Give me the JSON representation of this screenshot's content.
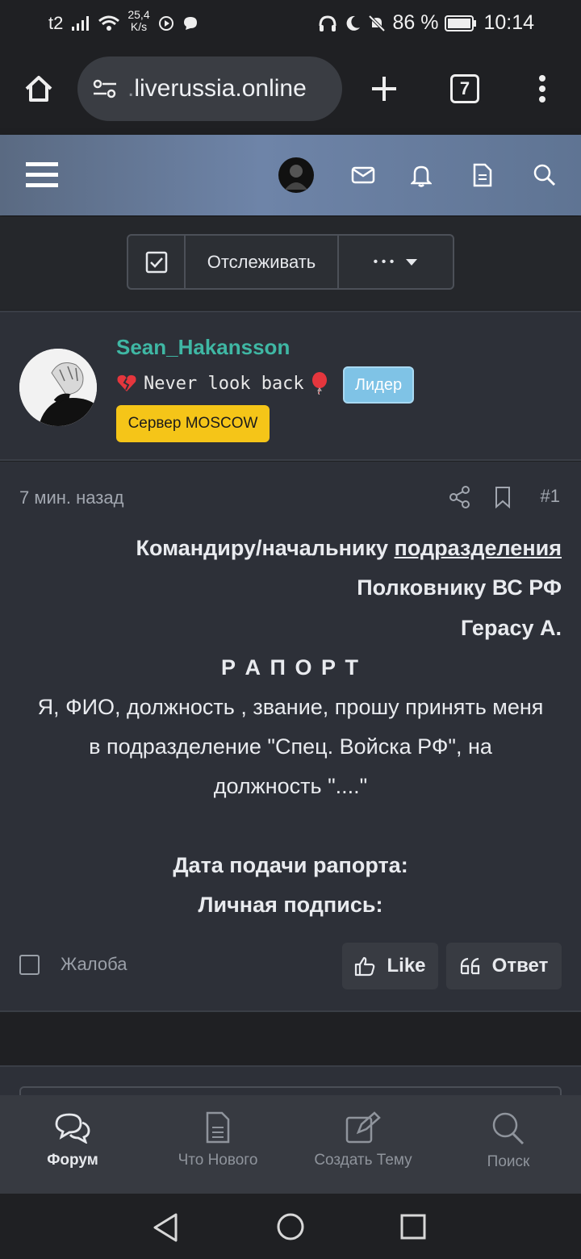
{
  "status": {
    "carrier": "t2",
    "speed_top": "25,4",
    "speed_bottom": "K/s",
    "battery": "86 %",
    "time": "10:14"
  },
  "browser": {
    "url_fade": "‎.",
    "url": "liverussia.online",
    "tab_count": "7"
  },
  "actions": {
    "follow_label": "Отслеживать",
    "more_label": "• • •"
  },
  "user": {
    "name": "Sean_Hakansson",
    "title": "Never look back",
    "leader_badge": "Лидер",
    "server_badge": "Сервер MOSCOW"
  },
  "post": {
    "time": "7 мин. назад",
    "number": "#1",
    "line1_a": "Командиру/начальнику ",
    "line1_b": "подразделения",
    "line2": "Полковнику ВС РФ",
    "line3": "Герасу А.",
    "heading": "Р А П О Р Т",
    "para1": "Я, ФИО, должность , звание, прошу принять меня",
    "para2": "в подразделение \"Спец. Войска РФ\", на",
    "para3": "должность \"....\"",
    "date_label": "Дата подачи рапорта:",
    "sign_label": "Личная подпись:",
    "complaint": "Жалоба",
    "like": "Like",
    "reply": "Ответ"
  },
  "tabs": [
    {
      "label": "Форум",
      "icon": "chat-bubbles-icon"
    },
    {
      "label": "Что Нового",
      "icon": "document-icon"
    },
    {
      "label": "Создать Тему",
      "icon": "edit-icon"
    },
    {
      "label": "Поиск",
      "icon": "search-icon"
    }
  ],
  "colors": {
    "username": "#3fb7a4",
    "leader_badge": "#7fc3e6",
    "server_badge": "#f5c518"
  }
}
